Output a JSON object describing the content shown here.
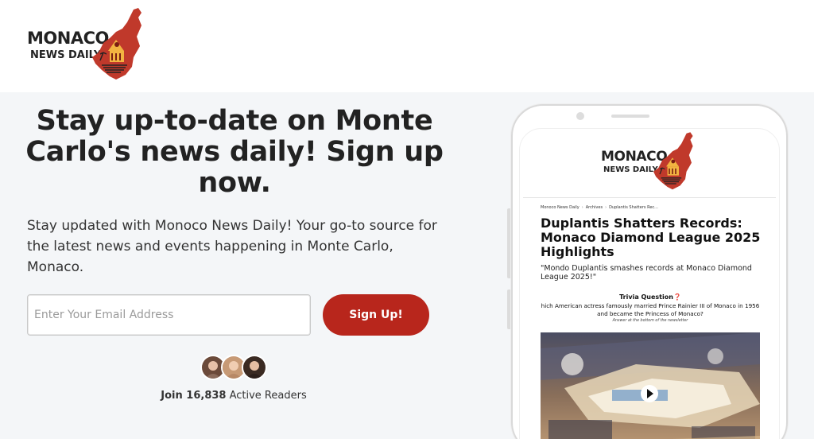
{
  "brand": {
    "line1": "MONACO",
    "line2": "NEWS DAILY",
    "accent_color": "#b8261c"
  },
  "hero": {
    "headline": "Stay up-to-date on Monte Carlo's news daily! Sign up now.",
    "subtext": "Stay updated with Monoco News Daily! Your go-to source for the latest news and events happening in Monte Carlo, Monaco.",
    "email_placeholder": "Enter Your Email Address",
    "signup_label": "Sign Up!",
    "readers_bold": "Join 16,838",
    "readers_rest": " Active Readers"
  },
  "preview": {
    "logo_line1": "MONACO",
    "logo_line2": "NEWS DAILY",
    "breadcrumb": [
      "Monoco News Daily",
      "Archives",
      "Duplantis Shatters Rec..."
    ],
    "breadcrumb_separator": "›",
    "article_title": "Duplantis Shatters Records: Monaco Diamond League 2025 Highlights",
    "article_subtitle": "\"Mondo Duplantis smashes records at Monaco Diamond League 2025!\"",
    "trivia_title": "Trivia Question❓",
    "trivia_question": "hich American actress famously married Prince Rainier III of Monaco in 1956 and became the Princess of Monaco?",
    "trivia_note": "Answer at the bottom of the newsletter"
  },
  "icons": {
    "logo": "monaco-map-logo-icon",
    "play": "play-icon"
  }
}
